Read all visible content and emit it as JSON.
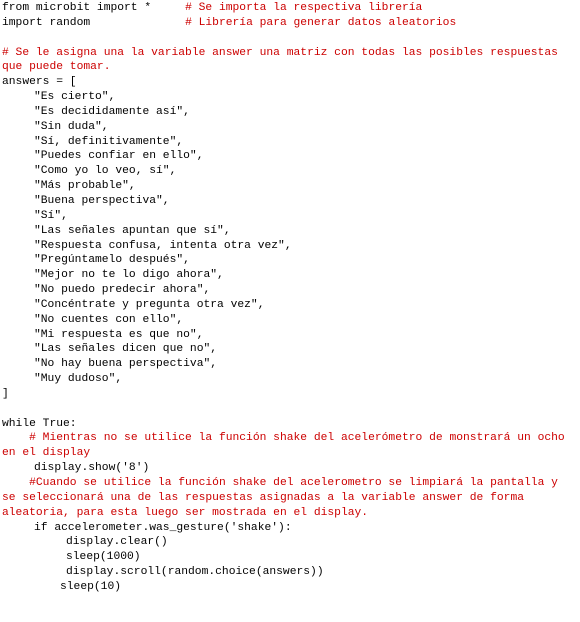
{
  "colors": {
    "comment": "#cc0000",
    "code": "#000000",
    "background": "#ffffff"
  },
  "code": {
    "import_microbit": "from microbit import *",
    "comment_import_microbit": "# Se importa la respectiva librería",
    "import_random": "import random",
    "comment_import_random": "# Librería para generar datos aleatorios",
    "comment_answers": "# Se le asigna una la variable answer una matriz con todas las posibles respuestas que puede tomar.",
    "answers_open": "answers = [",
    "answers": [
      "\"Es cierto\",",
      "\"Es decididamente así\",",
      "\"Sin duda\",",
      "\"Sí, definitivamente\",",
      "\"Puedes confiar en ello\",",
      "\"Como yo lo veo, sí\",",
      "\"Más probable\",",
      "\"Buena perspectiva\",",
      "\"Sí\",",
      "\"Las señales apuntan que sí\",",
      "\"Respuesta confusa, intenta otra vez\",",
      "\"Pregúntamelo después\",",
      "\"Mejor no te lo digo ahora\",",
      "\"No puedo predecir ahora\",",
      "\"Concéntrate y pregunta otra vez\",",
      "\"No cuentes con ello\",",
      "\"Mi respuesta es que no\",",
      "\"Las señales dicen que no\",",
      "\"No hay buena perspectiva\",",
      "\"Muy dudoso\","
    ],
    "answers_close": "]",
    "while_true": "while True:",
    "comment_while": "# Mientras no se utilice la función shake del acelerómetro de monstrará un ocho en el display",
    "display_show": "display.show('8')",
    "comment_shake": "#Cuando se utilice la función shake del acelerometro se limpiará la pantalla y se seleccionará una de las respuestas asignadas a la variable answer de forma aleatoria, para esta luego ser mostrada en el display.",
    "if_gesture": "if accelerometer.was_gesture('shake'):",
    "display_clear": "display.clear()",
    "sleep_1000": "sleep(1000)",
    "display_scroll": "display.scroll(random.choice(answers))",
    "sleep_10": "sleep(10)"
  }
}
